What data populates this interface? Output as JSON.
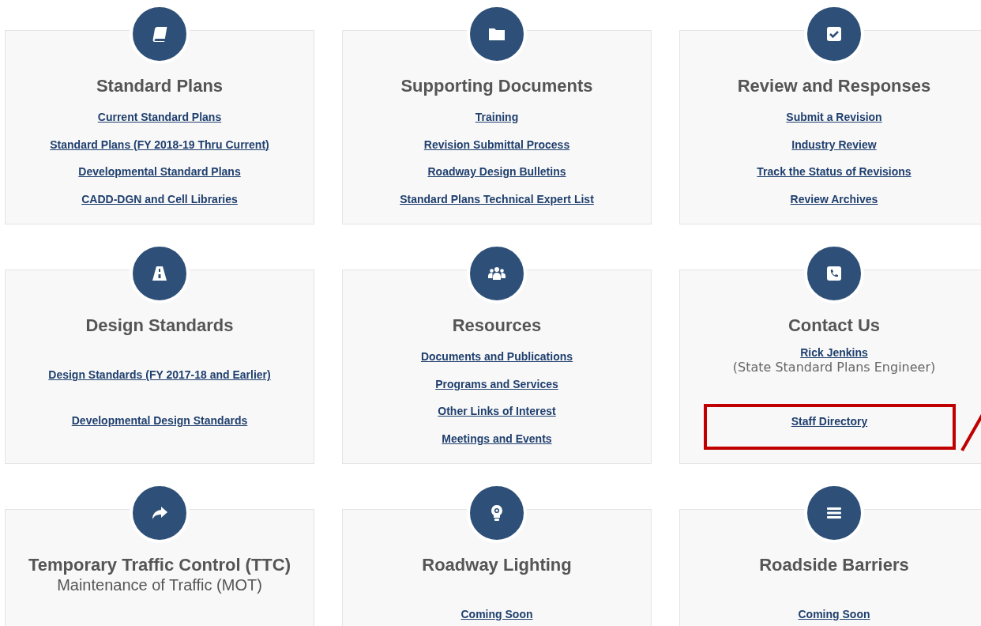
{
  "cards": [
    {
      "title": "Standard Plans",
      "items": [
        {
          "kind": "link",
          "text": "Current Standard Plans"
        },
        {
          "kind": "link",
          "text": "Standard Plans (FY 2018-19 Thru Current)"
        },
        {
          "kind": "link",
          "text": "Developmental Standard Plans"
        },
        {
          "kind": "link",
          "text": "CADD-DGN and Cell Libraries"
        }
      ]
    },
    {
      "title": "Supporting Documents",
      "items": [
        {
          "kind": "link",
          "text": "Training"
        },
        {
          "kind": "link",
          "text": "Revision Submittal Process"
        },
        {
          "kind": "link",
          "text": "Roadway Design Bulletins"
        },
        {
          "kind": "link",
          "text": "Standard Plans Technical Expert List"
        }
      ]
    },
    {
      "title": "Review and Responses",
      "items": [
        {
          "kind": "link",
          "text": "Submit a Revision"
        },
        {
          "kind": "link",
          "text": "Industry Review"
        },
        {
          "kind": "link",
          "text": "Track the Status of Revisions"
        },
        {
          "kind": "link",
          "text": "Review Archives"
        }
      ]
    },
    {
      "title": "Design Standards",
      "items": [
        {
          "kind": "link",
          "text": "Design Standards (FY 2017-18 and Earlier)"
        },
        {
          "kind": "link",
          "text": "Developmental Design Standards"
        }
      ]
    },
    {
      "title": "Resources",
      "items": [
        {
          "kind": "link",
          "text": "Documents and Publications"
        },
        {
          "kind": "link",
          "text": "Programs and Services"
        },
        {
          "kind": "link",
          "text": "Other Links of Interest"
        },
        {
          "kind": "link",
          "text": "Meetings and Events"
        }
      ]
    },
    {
      "title": "Contact Us",
      "items": [
        {
          "kind": "link",
          "text": "Rick Jenkins"
        },
        {
          "kind": "note",
          "text": "(State Standard Plans Engineer)"
        },
        {
          "kind": "link",
          "text": "Staff Directory",
          "highlighted": true
        }
      ]
    },
    {
      "title": "Temporary Traffic Control (TTC)",
      "subtitle": "Maintenance of Traffic (MOT)"
    },
    {
      "title": "Roadway Lighting",
      "items": [
        {
          "kind": "link",
          "text": "Coming Soon"
        }
      ]
    },
    {
      "title": "Roadside Barriers",
      "items": [
        {
          "kind": "link",
          "text": "Coming Soon"
        }
      ]
    }
  ]
}
